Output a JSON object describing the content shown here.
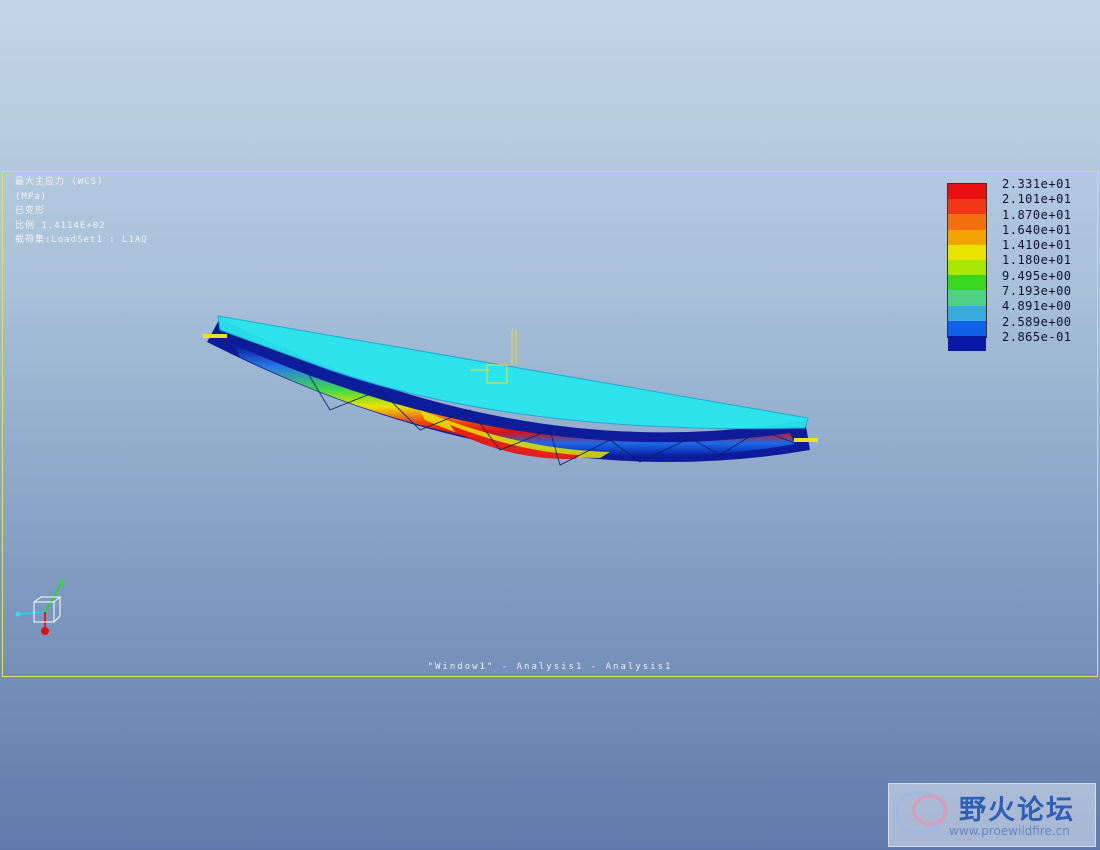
{
  "result_info": {
    "line1": "最大主应力 (WCS)",
    "line2": "(MPa)",
    "line3": "已变形",
    "line4": "比例  1.4114E+02",
    "line5": "载荷集:LoadSet1 :   L1AQ"
  },
  "legend": {
    "labels": [
      "2.331e+01",
      "2.101e+01",
      "1.870e+01",
      "1.640e+01",
      "1.410e+01",
      "1.180e+01",
      "9.495e+00",
      "7.193e+00",
      "4.891e+00",
      "2.589e+00",
      "2.865e-01"
    ],
    "colors": [
      "#e81010",
      "#f03818",
      "#f27010",
      "#f4a400",
      "#e8e400",
      "#a8e800",
      "#38d820",
      "#50d088",
      "#38aadc",
      "#1060e8",
      "#0a1aa0"
    ]
  },
  "caption": "\"Window1\" - Analysis1 - Analysis1",
  "watermark": {
    "title": "野火论坛",
    "url": "www.proewildfire.cn"
  },
  "colors": {
    "viewport_border": "#e4e05a",
    "undeformed": "#29e6ee",
    "constraint": "#f0e020"
  }
}
